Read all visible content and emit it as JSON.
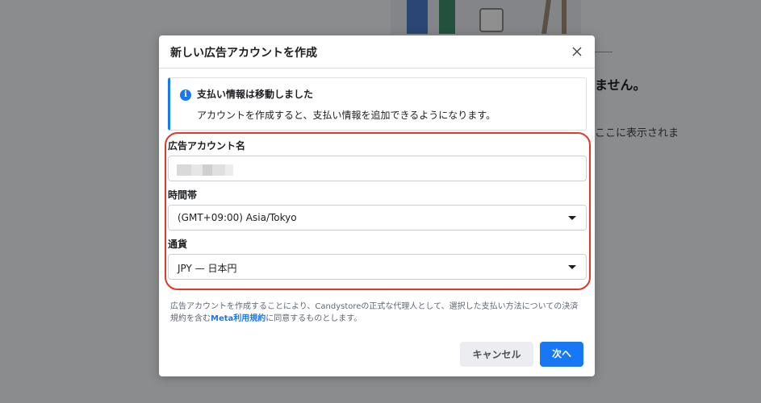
{
  "background": {
    "heading": "ません。",
    "text": "ここに表示されま"
  },
  "modal": {
    "title": "新しい広告アカウントを作成",
    "info": {
      "icon": "info-icon",
      "title": "支払い情報は移動しました",
      "body": "アカウントを作成すると、支払い情報を追加できるようになります。"
    },
    "fields": {
      "account_name": {
        "label": "広告アカウント名",
        "value": ""
      },
      "timezone": {
        "label": "時間帯",
        "value": "(GMT+09:00) Asia/Tokyo"
      },
      "currency": {
        "label": "通貨",
        "value": "JPY — 日本円"
      }
    },
    "terms": {
      "text_before": "広告アカウントを作成することにより、Candystoreの正式な代理人として、選択した支払い方法についての決済規約を含む",
      "link": "Meta利用規約",
      "text_after": "に同意するものとします。"
    },
    "buttons": {
      "cancel": "キャンセル",
      "next": "次へ"
    }
  },
  "colors": {
    "accent": "#1877f2",
    "highlight": "#e4372c"
  }
}
